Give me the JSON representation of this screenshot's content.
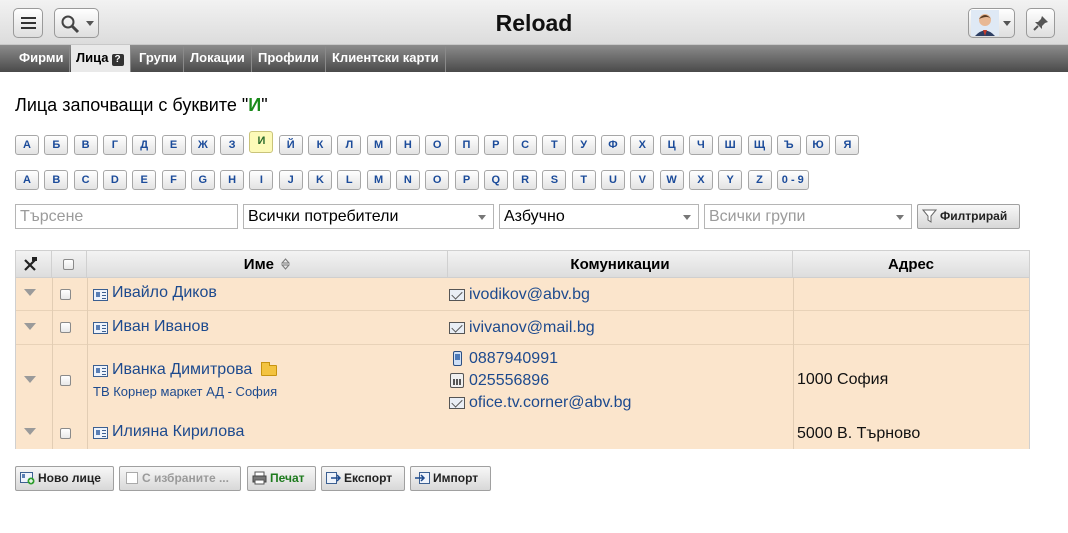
{
  "app": {
    "title": "Reload"
  },
  "tabs": [
    {
      "label": "Фирми"
    },
    {
      "label": "Лица",
      "active": true,
      "help": "?"
    },
    {
      "label": "Групи"
    },
    {
      "label": "Локации"
    },
    {
      "label": "Профили"
    },
    {
      "label": "Клиентски карти"
    }
  ],
  "heading": {
    "prefix": "Лица започващи с буквите \"",
    "letter": "И",
    "suffix": "\""
  },
  "letters_cyrillic": [
    "А",
    "Б",
    "В",
    "Г",
    "Д",
    "Е",
    "Ж",
    "З",
    "И",
    "Й",
    "К",
    "Л",
    "М",
    "Н",
    "О",
    "П",
    "Р",
    "С",
    "Т",
    "У",
    "Ф",
    "Х",
    "Ц",
    "Ч",
    "Ш",
    "Щ",
    "Ъ",
    "Ю",
    "Я"
  ],
  "active_letter": "И",
  "letters_latin": [
    "A",
    "B",
    "C",
    "D",
    "E",
    "F",
    "G",
    "H",
    "I",
    "J",
    "K",
    "L",
    "M",
    "N",
    "O",
    "P",
    "Q",
    "R",
    "S",
    "T",
    "U",
    "V",
    "W",
    "X",
    "Y",
    "Z",
    "0 - 9"
  ],
  "filters": {
    "search_placeholder": "Търсене",
    "users_select": "Всички потребители",
    "sort_select": "Азбучно",
    "groups_placeholder": "Всички групи",
    "filter_button": "Филтрирай"
  },
  "table": {
    "columns": {
      "name": "Име",
      "communications": "Комуникации",
      "address": "Адрес"
    },
    "rows": [
      {
        "name": "Ивайло Диков",
        "company": "",
        "phones": [],
        "email": "ivodikov@abv.bg",
        "address": ""
      },
      {
        "name": "Иван Иванов",
        "company": "",
        "phones": [],
        "email": "ivivanov@mail.bg",
        "address": ""
      },
      {
        "name": "Иванка Димитрова",
        "company": "ТВ Корнер маркет АД - София",
        "mobile": "0887940991",
        "landline": "025556896",
        "email": "ofice.tv.corner@abv.bg",
        "address": "1000 София"
      },
      {
        "name": "Илияна Кирилова",
        "company": "",
        "phones": [],
        "email": "",
        "address": "5000 В. Търново"
      }
    ]
  },
  "actions": {
    "new_person": "Ново лице",
    "with_selected": "С избраните ...",
    "print": "Печат",
    "export": "Експорт",
    "import": "Импорт"
  },
  "colors": {
    "row_bg": "#fbe5cc",
    "link": "#1d4a8e",
    "accent_green": "#1a8a1a"
  }
}
